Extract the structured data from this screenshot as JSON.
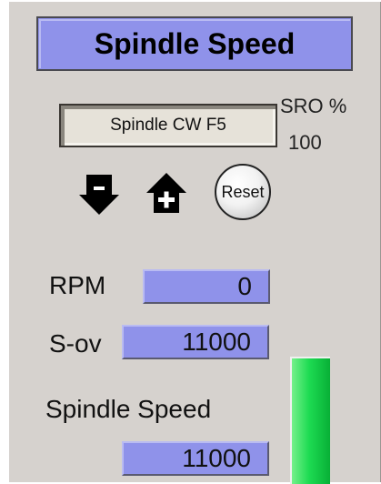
{
  "panel": {
    "title": "Spindle Speed",
    "spindle_button_label": "Spindle CW F5",
    "sro_label": "SRO %",
    "sro_value": "100",
    "reset_label": "Reset",
    "rpm_label": "RPM",
    "rpm_value": "0",
    "sov_label": "S-ov",
    "sov_value": "11000",
    "spindle_speed_label": "Spindle Speed",
    "spindle_speed_value": "11000",
    "speed_bar_level": 1.0
  },
  "icons": {
    "decrease": "down-arrow-icon",
    "increase": "up-arrow-plus-icon"
  },
  "colors": {
    "panel_bg": "#d6d2ce",
    "value_box": "#8f92ea",
    "bar_green": "#1ddb52"
  }
}
